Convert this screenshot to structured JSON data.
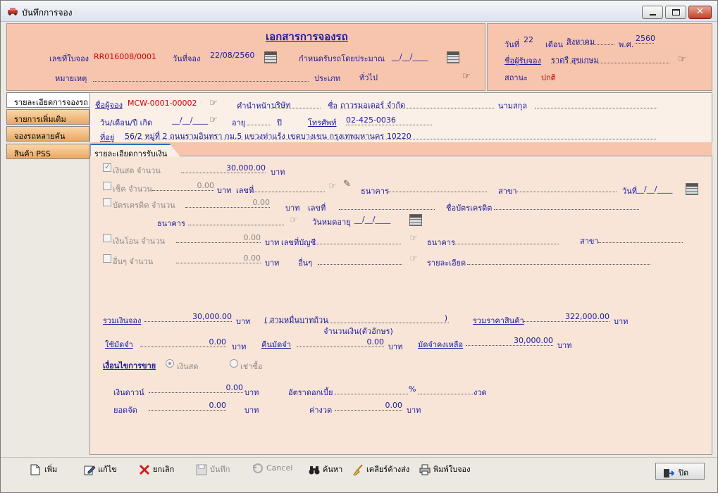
{
  "window": {
    "title": "บันทึกการจอง"
  },
  "header": {
    "doc_title": "เอกสารการจองรถ",
    "booking_no_label": "เลขที่ใบจอง",
    "booking_no": "RR016008/0001",
    "booking_date_label": "วันที่จอง",
    "booking_date": "22/08/2560",
    "due_label": "กำหนดรับรถโดยประมาณ",
    "due_value": "__/__/____",
    "note_label": "หมายเหตุ",
    "type_label": "ประเภท",
    "type_value": "ทั่วไป",
    "day_label": "วันที่",
    "day_value": "22",
    "month_label": "เดือน",
    "month_value": "สิงหาคม",
    "year_label": "พ.ศ.",
    "year_value": "2560",
    "receiver_label": "ชื่อผู้รับจอง",
    "receiver_value": "ราตรี สุขเกษม",
    "status_label": "สถานะ",
    "status_value": "ปกติ"
  },
  "tabs": [
    {
      "label": "รายละเอียดการจองรถ"
    },
    {
      "label": "รายการเพิ่มเติม"
    },
    {
      "label": "จองรถหลายคัน"
    },
    {
      "label": "สินค้า PSS"
    }
  ],
  "customer": {
    "booker_label": "ชื่อผู้จอง",
    "booker_code": "MCW-0001-00002",
    "prefix_label": "คำนำหน้า",
    "prefix_value": "บริษัท",
    "name_label": "ชื่อ",
    "name_value": "ถาวรมอเตอร์ จำกัด",
    "surname_label": "นามสกุล",
    "dob_label": "วัน/เดือน/ปี เกิด",
    "dob_value": "__/__/____",
    "age_label": "อายุ",
    "year_unit": "ปี",
    "phone_label": "โทรศัพท์",
    "phone_value": "02-425-0036",
    "address_label": "ที่อยู่",
    "address_value": "56/2 หมู่ที่ 2 ถนนรามอินทรา กม.5 แขวงท่าแร้ง เขตบางเขน กรุงเทพมหานคร 10220"
  },
  "payment_tab": {
    "label": "รายละเอียดการรับเงิน"
  },
  "payment": {
    "cash_label": "เงินสด จำนวน",
    "cash_value": "30,000.00",
    "baht": "บาท",
    "cheque_label": "เช็ค จำนวน",
    "cheque_value": "0.00",
    "no_label": "เลขที่",
    "bank_label": "ธนาคาร",
    "branch_label": "สาขา",
    "date_label": "วันที่",
    "date_value": "__/__/____",
    "card_label": "บัตรเครดิต จำนวน",
    "card_value": "0.00",
    "card_name_label": "ชื่อบัตรเครดิต",
    "expiry_label": "วันหมดอายุ",
    "expiry_value": "__/__/____",
    "transfer_label": "เงินโอน จำนวน",
    "transfer_value": "0.00",
    "account_label": "เลขที่บัญชี",
    "other_label": "อื่นๆ จำนวน",
    "other_value": "0.00",
    "other_text_label": "อื่นๆ",
    "detail_label": "รายละเอียด"
  },
  "summary": {
    "total_booking_label": "รวมเงินจอง",
    "total_booking_value": "30,000.00",
    "amount_text": "( สามหมื่นบาทถ้วน",
    "amount_text_close": ")",
    "amount_text_caption": "จำนวนเงิน(ตัวอักษร)",
    "total_price_label": "รวมราคาสินค้า",
    "total_price_value": "322,000.00",
    "deposit_used_label": "ใช้มัดจำ",
    "deposit_used_value": "0.00",
    "deposit_return_label": "คืนมัดจำ",
    "deposit_return_value": "0.00",
    "deposit_remain_label": "มัดจำคงเหลือ",
    "deposit_remain_value": "30,000.00",
    "sale_cond_label": "เงื่อนไขการขาย",
    "cond_cash": "เงินสด",
    "cond_hire": "เช่าซื้อ",
    "down_label": "เงินดาวน์",
    "down_value": "0.00",
    "rate_label": "อัตราดอกเบี้ย",
    "percent": "%",
    "period_unit": "งวด",
    "finance_label": "ยอดจัด",
    "finance_value": "0.00",
    "installment_label": "ค่างวด",
    "installment_value": "0.00"
  },
  "toolbar": {
    "add": "เพิ่ม",
    "edit": "แก้ไข",
    "cancel_doc": "ยกเลิก",
    "save": "บันทึก",
    "cancel": "Cancel",
    "search": "ค้นหา",
    "clear": "เคลียร์ค้างส่ง",
    "print": "พิมพ์ใบจอง",
    "close": "ปิด"
  }
}
